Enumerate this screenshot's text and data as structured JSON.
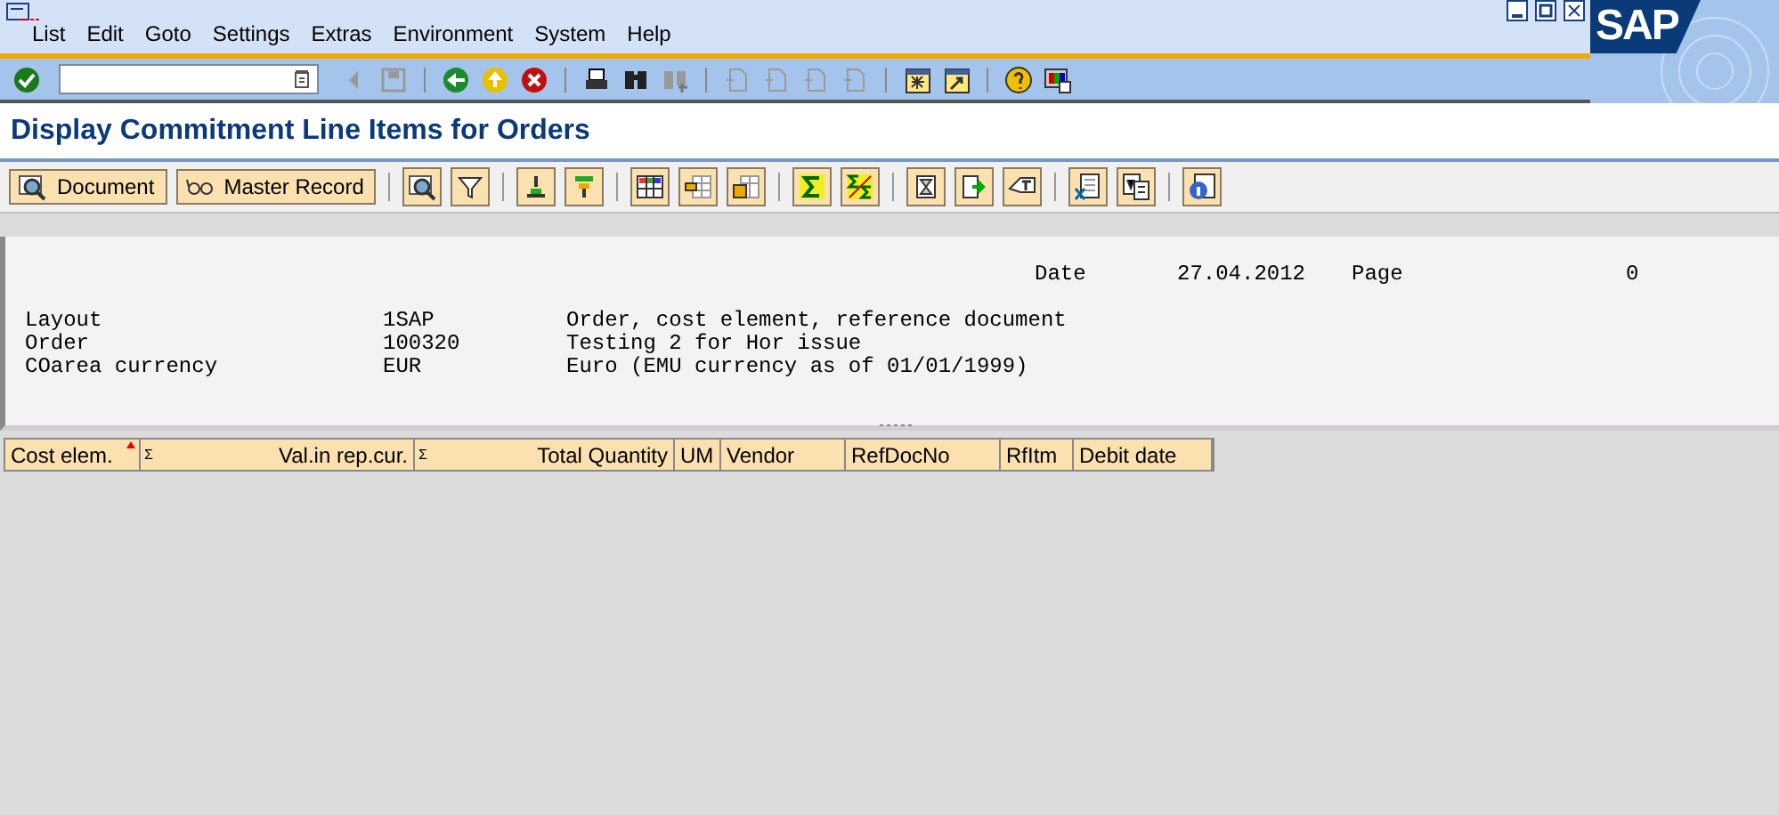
{
  "menu": [
    "List",
    "Edit",
    "Goto",
    "Settings",
    "Extras",
    "Environment",
    "System",
    "Help"
  ],
  "logo": "SAP",
  "title": "Display Commitment Line Items for Orders",
  "app_buttons": [
    "Document",
    "Master Record"
  ],
  "header": {
    "date_label": "Date",
    "date": "27.04.2012",
    "page_label": "Page",
    "page": "0"
  },
  "info_rows": [
    {
      "label": "Layout",
      "value": "1SAP",
      "text": "Order, cost element, reference document"
    },
    {
      "label": "Order",
      "value": "100320",
      "text": "Testing 2 for Hor issue"
    },
    {
      "label": "COarea currency",
      "value": "EUR",
      "text": "Euro (EMU currency as of 01/01/1999)"
    }
  ],
  "columns": [
    {
      "label": "Cost elem.",
      "kind": "text",
      "sorted": true
    },
    {
      "label": "Val.in rep.cur.",
      "kind": "amount",
      "sum_mark": "Σ",
      "sorted": false
    },
    {
      "label": "Total Quantity",
      "kind": "amount",
      "sum_mark": "Σ",
      "sorted": false
    },
    {
      "label": "UM",
      "kind": "text",
      "sorted": false
    },
    {
      "label": "Vendor",
      "kind": "text",
      "sorted": false
    },
    {
      "label": "RefDocNo",
      "kind": "text",
      "sorted": false
    },
    {
      "label": "RfItm",
      "kind": "text",
      "sorted": false
    },
    {
      "label": "Debit date",
      "kind": "text",
      "sorted": false
    }
  ]
}
